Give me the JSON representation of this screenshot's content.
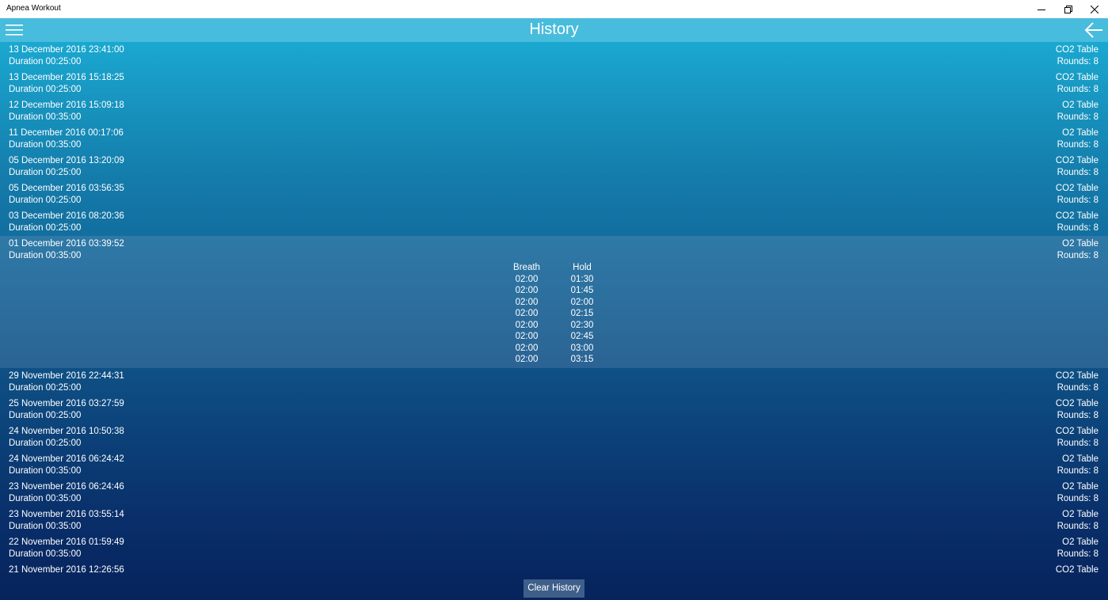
{
  "window": {
    "title": "Apnea Workout"
  },
  "header": {
    "title": "History",
    "menu_icon": "hamburger-icon",
    "back_icon": "back-arrow-icon"
  },
  "history": [
    {
      "datetime": "13 December 2016 23:41:00",
      "duration": "Duration 00:25:00",
      "type": "CO2 Table",
      "rounds": "Rounds: 8"
    },
    {
      "datetime": "13 December 2016 15:18:25",
      "duration": "Duration 00:25:00",
      "type": "CO2 Table",
      "rounds": "Rounds: 8"
    },
    {
      "datetime": "12 December 2016 15:09:18",
      "duration": "Duration 00:35:00",
      "type": "O2 Table",
      "rounds": "Rounds: 8"
    },
    {
      "datetime": "11 December 2016 00:17:06",
      "duration": "Duration 00:35:00",
      "type": "O2 Table",
      "rounds": "Rounds: 8"
    },
    {
      "datetime": "05 December 2016 13:20:09",
      "duration": "Duration 00:25:00",
      "type": "CO2 Table",
      "rounds": "Rounds: 8"
    },
    {
      "datetime": "05 December 2016 03:56:35",
      "duration": "Duration 00:25:00",
      "type": "CO2 Table",
      "rounds": "Rounds: 8"
    },
    {
      "datetime": "03 December 2016 08:20:36",
      "duration": "Duration 00:25:00",
      "type": "CO2 Table",
      "rounds": "Rounds: 8"
    },
    {
      "datetime": "01 December 2016 03:39:52",
      "duration": "Duration 00:35:00",
      "type": "O2 Table",
      "rounds": "Rounds: 8"
    },
    {
      "datetime": "29 November 2016 22:44:31",
      "duration": "Duration 00:25:00",
      "type": "CO2 Table",
      "rounds": "Rounds: 8"
    },
    {
      "datetime": "25 November 2016 03:27:59",
      "duration": "Duration 00:25:00",
      "type": "CO2 Table",
      "rounds": "Rounds: 8"
    },
    {
      "datetime": "24 November 2016 10:50:38",
      "duration": "Duration 00:25:00",
      "type": "CO2 Table",
      "rounds": "Rounds: 8"
    },
    {
      "datetime": "24 November 2016 06:24:42",
      "duration": "Duration 00:35:00",
      "type": "O2 Table",
      "rounds": "Rounds: 8"
    },
    {
      "datetime": "23 November 2016 06:24:46",
      "duration": "Duration 00:35:00",
      "type": "O2 Table",
      "rounds": "Rounds: 8"
    },
    {
      "datetime": "23 November 2016 03:55:14",
      "duration": "Duration 00:35:00",
      "type": "O2 Table",
      "rounds": "Rounds: 8"
    },
    {
      "datetime": "22 November 2016 01:59:49",
      "duration": "Duration 00:35:00",
      "type": "O2 Table",
      "rounds": "Rounds: 8"
    },
    {
      "datetime": "21 November 2016 12:26:56",
      "duration": "",
      "type": "CO2 Table",
      "rounds": ""
    }
  ],
  "expanded_detail": {
    "breath_header": "Breath",
    "hold_header": "Hold",
    "breath": [
      "02:00",
      "02:00",
      "02:00",
      "02:00",
      "02:00",
      "02:00",
      "02:00",
      "02:00"
    ],
    "hold": [
      "01:30",
      "01:45",
      "02:00",
      "02:15",
      "02:30",
      "02:45",
      "03:00",
      "03:15"
    ]
  },
  "clear_button": {
    "label": "Clear History"
  }
}
